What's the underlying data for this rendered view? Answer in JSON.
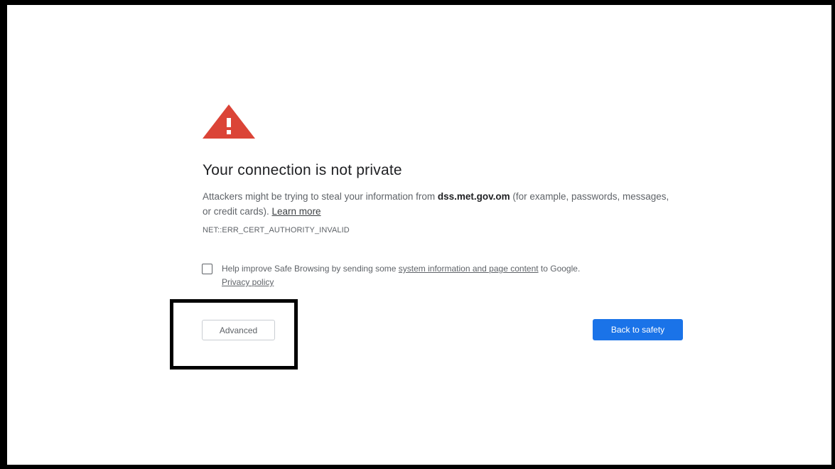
{
  "interstitial": {
    "title": "Your connection is not private",
    "description_prefix": "Attackers might be trying to steal your information from ",
    "domain": "dss.met.gov.om",
    "description_suffix": " (for example, passwords, messages, or credit cards). ",
    "learn_more": "Learn more",
    "error_code": "NET::ERR_CERT_AUTHORITY_INVALID",
    "safe_browsing": {
      "checked": false,
      "prefix": "Help improve Safe Browsing by sending some ",
      "link_text": "system information and page content",
      "suffix": " to Google. ",
      "privacy_link": "Privacy policy"
    },
    "buttons": {
      "advanced": "Advanced",
      "back_to_safety": "Back to safety"
    },
    "icon": "warning-triangle-icon",
    "colors": {
      "warning": "#db4437",
      "primary_button": "#1a73e8",
      "annotation_box": "#000000"
    }
  }
}
